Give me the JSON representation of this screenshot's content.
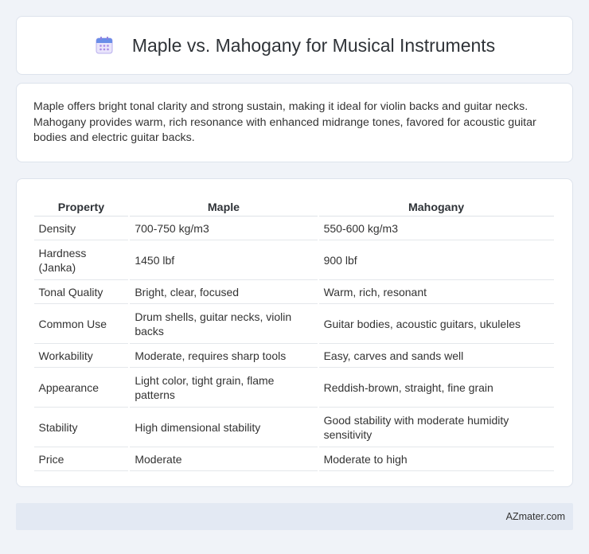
{
  "header": {
    "title": "Maple vs. Mahogany for Musical Instruments",
    "icon": "calendar-icon"
  },
  "summary": {
    "text": "Maple offers bright tonal clarity and strong sustain, making it ideal for violin backs and guitar necks. Mahogany provides warm, rich resonance with enhanced midrange tones, favored for acoustic guitar bodies and electric guitar backs."
  },
  "table": {
    "headers": [
      "Property",
      "Maple",
      "Mahogany"
    ],
    "rows": [
      [
        "Density",
        "700-750 kg/m3",
        "550-600 kg/m3"
      ],
      [
        "Hardness (Janka)",
        "1450 lbf",
        "900 lbf"
      ],
      [
        "Tonal Quality",
        "Bright, clear, focused",
        "Warm, rich, resonant"
      ],
      [
        "Common Use",
        "Drum shells, guitar necks, violin backs",
        "Guitar bodies, acoustic guitars, ukuleles"
      ],
      [
        "Workability",
        "Moderate, requires sharp tools",
        "Easy, carves and sands well"
      ],
      [
        "Appearance",
        "Light color, tight grain, flame patterns",
        "Reddish-brown, straight, fine grain"
      ],
      [
        "Stability",
        "High dimensional stability",
        "Good stability with moderate humidity sensitivity"
      ],
      [
        "Price",
        "Moderate",
        "Moderate to high"
      ]
    ]
  },
  "footer": {
    "text": "AZmater.com"
  }
}
